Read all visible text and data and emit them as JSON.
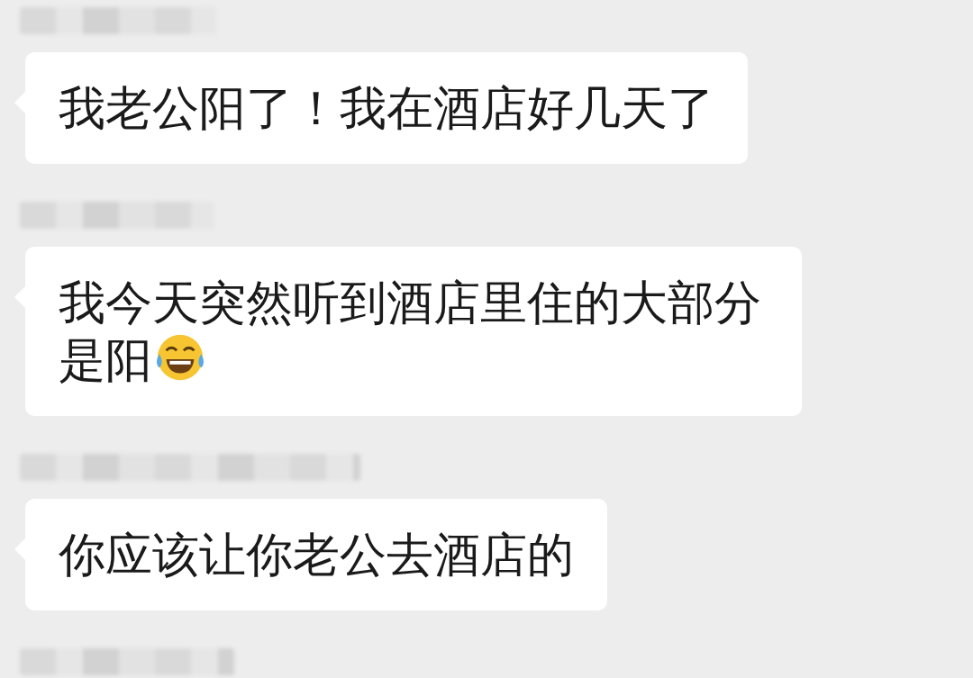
{
  "messages": [
    {
      "kind": "text",
      "sender_blurred": true,
      "text": "我老公阳了！我在酒店好几天了"
    },
    {
      "kind": "text",
      "sender_blurred": true,
      "text": "我今天突然听到酒店里住的大部分是阳",
      "ends_with_laughing_emoji": true
    },
    {
      "kind": "text",
      "sender_blurred": true,
      "text": "你应该让你老公去酒店的"
    },
    {
      "kind": "cut",
      "sender_blurred": true
    }
  ]
}
